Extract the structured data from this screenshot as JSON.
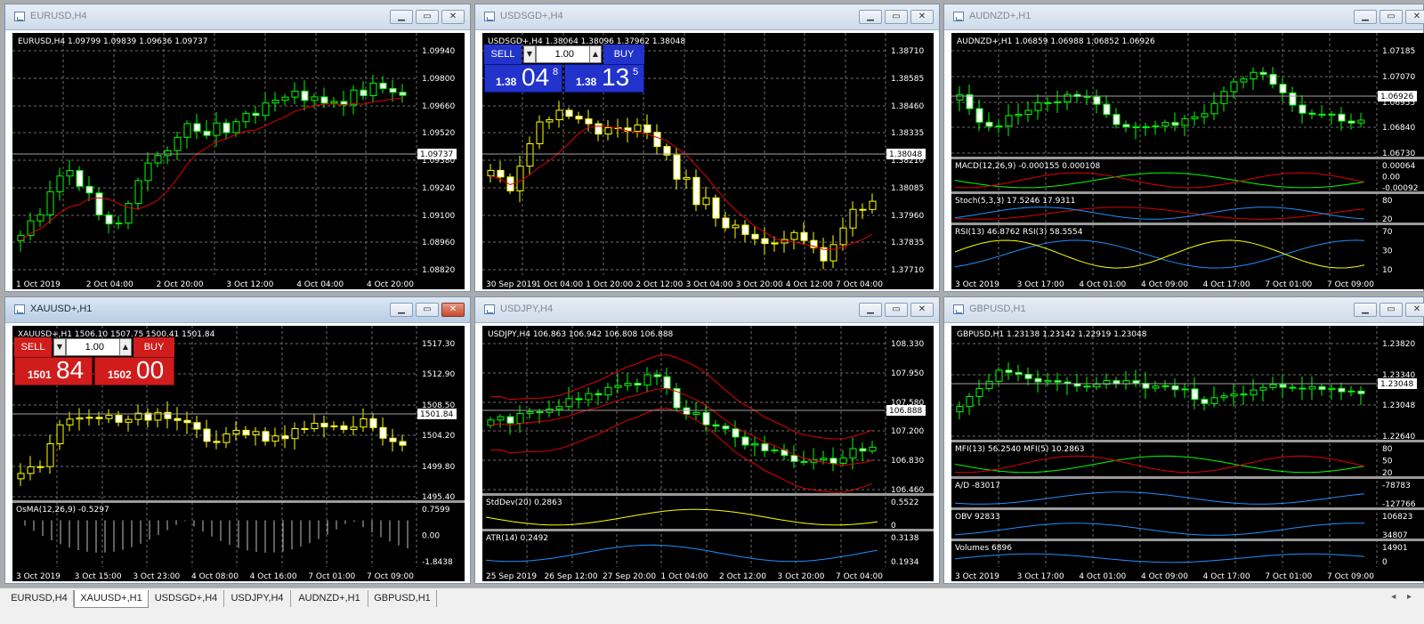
{
  "windows": [
    {
      "id": "w1",
      "title": "EURUSD,H4",
      "header": "EURUSD,H4  1.09799 1.09839 1.09636 1.09737",
      "yticks": [
        "1.09940",
        "1.09800",
        "1.09660",
        "1.09520",
        "1.09380",
        "1.09240",
        "1.09100",
        "1.08960",
        "1.08820"
      ],
      "xticks": [
        "1 Oct 2019",
        "2 Oct 04:00",
        "2 Oct 20:00",
        "3 Oct 12:00",
        "4 Oct 04:00",
        "4 Oct 20:00"
      ],
      "price": "1.09737",
      "color": "#00ff00",
      "panes": []
    },
    {
      "id": "w2",
      "title": "USDSGD+,H4",
      "header": "USDSGD+,H4  1.38064 1.38096 1.37962 1.38048",
      "yticks": [
        "1.38710",
        "1.38585",
        "1.38460",
        "1.38335",
        "1.38210",
        "1.38085",
        "1.37960",
        "1.37835",
        "1.37710"
      ],
      "xticks": [
        "30 Sep 2019",
        "1 Oct 04:00",
        "1 Oct 20:00",
        "2 Oct 12:00",
        "3 Oct 04:00",
        "3 Oct 20:00",
        "4 Oct 12:00",
        "7 Oct 04:00"
      ],
      "price": "1.38048",
      "color": "#ffff00",
      "panes": []
    },
    {
      "id": "w3",
      "title": "AUDNZD+,H1",
      "header": "AUDNZD+,H1  1.06859 1.06988 1.06852 1.06926",
      "yticks": [
        "1.07185",
        "1.07070",
        "1.06955",
        "1.06840",
        "1.06730"
      ],
      "xticks": [
        "3 Oct 2019",
        "3 Oct 17:00",
        "4 Oct 01:00",
        "4 Oct 09:00",
        "4 Oct 17:00",
        "7 Oct 01:00",
        "7 Oct 09:00"
      ],
      "price": "1.06926",
      "color": "#00ff00",
      "panes": [
        {
          "label": "MACD(12,26,9) -0.000155 0.000108",
          "ticks": [
            "0.00064",
            "0.00",
            "-0.00092"
          ]
        },
        {
          "label": "Stoch(5,3,3) 17.5246 17.9311",
          "ticks": [
            "80",
            "20"
          ]
        },
        {
          "label": "RSI(13) 46.8762  RSI(3) 58.5554",
          "ticks": [
            "70",
            "30",
            "10"
          ]
        }
      ]
    },
    {
      "id": "w4",
      "title": "XAUUSD+,H1",
      "header": "XAUUSD+,H1  1506.10 1507.75 1500.41 1501.84",
      "yticks": [
        "1517.30",
        "1512.90",
        "1508.50",
        "1504.20",
        "1499.80",
        "1495.40"
      ],
      "xticks": [
        "3 Oct 2019",
        "3 Oct 15:00",
        "3 Oct 23:00",
        "4 Oct 08:00",
        "4 Oct 16:00",
        "7 Oct 01:00",
        "7 Oct 09:00"
      ],
      "price": "1501.84",
      "color": "#ffff00",
      "panes": [
        {
          "label": "OsMA(12,26,9) -0.5297",
          "ticks": [
            "0.7599",
            "0.00",
            "-1.8438"
          ]
        }
      ]
    },
    {
      "id": "w5",
      "title": "USDJPY,H4",
      "header": "USDJPY,H4  106.863 106.942 106.808 106.888",
      "yticks": [
        "108.330",
        "107.950",
        "107.580",
        "107.200",
        "106.830",
        "106.460"
      ],
      "xticks": [
        "25 Sep 2019",
        "26 Sep 12:00",
        "27 Sep 20:00",
        "1 Oct 04:00",
        "2 Oct 12:00",
        "3 Oct 20:00",
        "7 Oct 04:00"
      ],
      "price": "106.888",
      "color": "#00ff00",
      "panes": [
        {
          "label": "StdDev(20) 0.2863",
          "ticks": [
            "0.5522",
            "0"
          ]
        },
        {
          "label": "ATR(14) 0.2492",
          "ticks": [
            "0.3138",
            "0.1934"
          ]
        }
      ]
    },
    {
      "id": "w6",
      "title": "GBPUSD,H1",
      "header": "GBPUSD,H1  1.23138 1.23142 1.22919 1.23048",
      "yticks": [
        "1.23820",
        "1.23340",
        "1.23048",
        "1.22640"
      ],
      "xticks": [
        "3 Oct 2019",
        "3 Oct 17:00",
        "4 Oct 01:00",
        "4 Oct 09:00",
        "4 Oct 17:00",
        "7 Oct 01:00",
        "7 Oct 09:00"
      ],
      "price": "1.23048",
      "color": "#00ff00",
      "panes": [
        {
          "label": "MFI(13) 56.2540  MFI(5) 10.2863",
          "ticks": [
            "80",
            "50",
            "20"
          ]
        },
        {
          "label": "A/D -83017",
          "ticks": [
            "-78783",
            "-127766"
          ]
        },
        {
          "label": "OBV 92833",
          "ticks": [
            "106823",
            "34807"
          ]
        },
        {
          "label": "Volumes 6896",
          "ticks": [
            "14901",
            "0"
          ]
        }
      ]
    }
  ],
  "trade_usdsgd": {
    "sell": "SELL",
    "buy": "BUY",
    "lot": "1.00",
    "sell_small": "1.38",
    "sell_big": "04",
    "sell_sup": "8",
    "buy_small": "1.38",
    "buy_big": "13",
    "buy_sup": "5"
  },
  "trade_xauusd": {
    "sell": "SELL",
    "buy": "BUY",
    "lot": "1.00",
    "sell_small": "1501",
    "sell_big": "84",
    "buy_small": "1502",
    "buy_big": "00"
  },
  "tabs": [
    "EURUSD,H4",
    "XAUUSD+,H1",
    "USDSGD+,H4",
    "USDJPY,H4",
    "AUDNZD+,H1",
    "GBPUSD,H1"
  ],
  "selected_tab": "XAUUSD+,H1",
  "colors": {
    "sell_blue": "#2233cc",
    "sell_red": "#d11c1c",
    "ma_red": "#e00000",
    "grid": "#7f7f7f"
  }
}
